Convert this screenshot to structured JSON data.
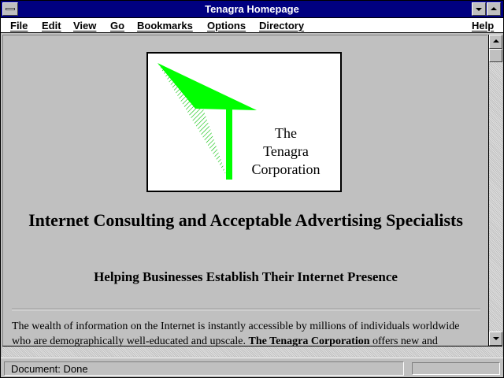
{
  "window": {
    "title": "Tenagra Homepage"
  },
  "menu": {
    "items": [
      {
        "label": "File"
      },
      {
        "label": "Edit"
      },
      {
        "label": "View"
      },
      {
        "label": "Go"
      },
      {
        "label": "Bookmarks"
      },
      {
        "label": "Options"
      },
      {
        "label": "Directory"
      },
      {
        "label": "Help"
      }
    ]
  },
  "logo": {
    "line1": "The",
    "line2": "Tenagra",
    "line3": "Corporation",
    "color": "#00ff00"
  },
  "page": {
    "headline": "Internet Consulting and Acceptable Advertising Specialists",
    "subheadline": "Helping Businesses Establish Their Internet Presence",
    "body_part1": "The wealth of information on the Internet is instantly accessible by millions of individuals worldwide who are demographically well-educated and upscale. ",
    "body_bold": "The Tenagra Corporation",
    "body_part2": " offers new and"
  },
  "status": {
    "text": "Document: Done"
  },
  "colors": {
    "titlebar": "#000080",
    "chrome": "#c0c0c0"
  }
}
